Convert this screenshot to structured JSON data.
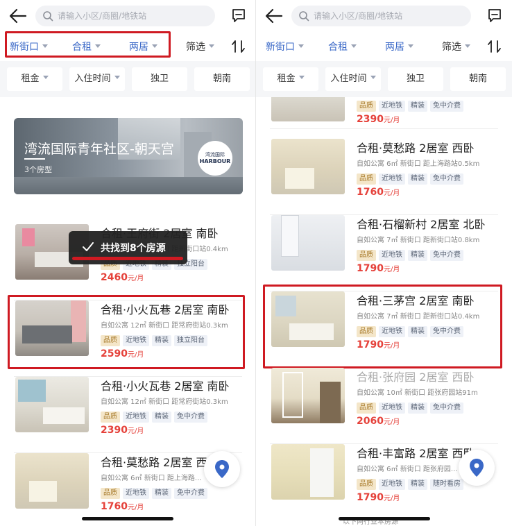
{
  "search": {
    "placeholder": "请输入小区/商圈/地铁站"
  },
  "filters": {
    "district": "新街口",
    "rent_type": "合租",
    "rooms": "两居",
    "more": "筛选"
  },
  "chips": [
    "租金",
    "入住时间",
    "独卫",
    "朝南"
  ],
  "banner": {
    "title": "湾流国际青年社区-朝天宫",
    "subtitle": "3个房型",
    "logo_line1": "湾流国际",
    "logo_line2": "HARBOUR"
  },
  "toast": {
    "text": "共找到8个房源"
  },
  "left_listings": [
    {
      "title": "合租·王府街 2居室 南卧",
      "desc": "自如公寓  11㎡ 新街口 距新街口站0.4km",
      "tags": [
        "品质",
        "近地铁",
        "精装",
        "独立阳台"
      ],
      "price": "2460",
      "unit": "元/月"
    },
    {
      "title": "合租·小火瓦巷 2居室 南卧",
      "desc": "自如公寓  12㎡ 新街口 距常府街站0.3km",
      "tags": [
        "品质",
        "近地铁",
        "精装",
        "独立阳台"
      ],
      "price": "2590",
      "unit": "元/月"
    },
    {
      "title": "合租·小火瓦巷 2居室 南卧",
      "desc": "自如公寓  12㎡ 新街口 距常府街站0.3km",
      "tags": [
        "品质",
        "近地铁",
        "精装",
        "免中介费"
      ],
      "price": "2390",
      "unit": "元/月"
    },
    {
      "title": "合租·莫愁路 2居室 西卧",
      "desc": "自如公寓  6㎡ 新街口 距上海路...",
      "tags": [
        "品质",
        "近地铁",
        "精装",
        "免中介费"
      ],
      "price": "1760",
      "unit": "元/月"
    }
  ],
  "right_listings": [
    {
      "title": "",
      "desc": "",
      "tags": [
        "品质",
        "近地铁",
        "精装",
        "免中介费"
      ],
      "price": "2390",
      "unit": "元/月"
    },
    {
      "title": "合租·莫愁路 2居室 西卧",
      "desc": "自如公寓  6㎡ 新街口 距上海路站0.5km",
      "tags": [
        "品质",
        "近地铁",
        "精装",
        "免中介费"
      ],
      "price": "1760",
      "unit": "元/月"
    },
    {
      "title": "合租·石榴新村 2居室 北卧",
      "desc": "自如公寓  7㎡ 新街口 距新街口站0.8km",
      "tags": [
        "品质",
        "近地铁",
        "精装",
        "免中介费"
      ],
      "price": "1790",
      "unit": "元/月"
    },
    {
      "title": "合租·三茅宫 2居室 南卧",
      "desc": "自如公寓  7㎡ 新街口 距新街口站0.4km",
      "tags": [
        "品质",
        "近地铁",
        "精装",
        "免中介费"
      ],
      "price": "1790",
      "unit": "元/月"
    },
    {
      "title": "合租·张府园 2居室 西卧",
      "desc": "自如公寓  10㎡ 新街口 距张府园站91m",
      "tags": [
        "品质",
        "近地铁",
        "精装",
        "免中介费"
      ],
      "price": "2060",
      "unit": "元/月"
    },
    {
      "title": "合租·丰富路 2居室 西卧",
      "desc": "自如公寓  6㎡ 新街口 距张府园...",
      "tags": [
        "品质",
        "近地铁",
        "精装",
        "随时看房"
      ],
      "price": "1790",
      "unit": "元/月"
    }
  ],
  "footer_hint": "以下两行业本房源",
  "colors": {
    "active": "#3a68c7",
    "price": "#e5413a",
    "highlight": "#cf1a22",
    "map_pin": "#3a68c7"
  },
  "icons": [
    "back-arrow-icon",
    "search-icon",
    "message-icon",
    "sort-icon",
    "check-icon",
    "map-pin-icon",
    "caret-down-icon"
  ]
}
